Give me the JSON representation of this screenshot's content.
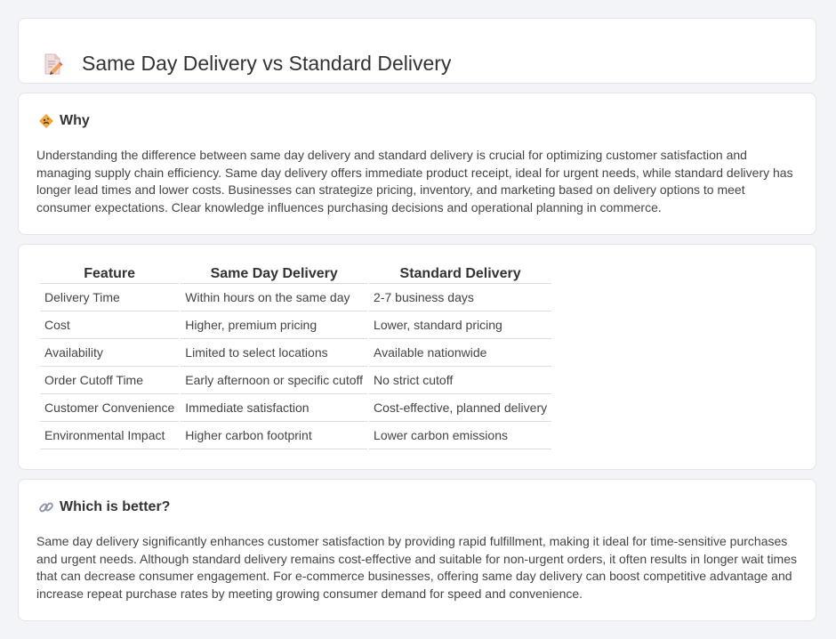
{
  "header": {
    "title": "Same Day Delivery vs Standard Delivery",
    "icon": "document-edit-icon"
  },
  "why": {
    "heading": "Why",
    "icon": "warning-diamond-icon",
    "body": "Understanding the difference between same day delivery and standard delivery is crucial for optimizing customer satisfaction and managing supply chain efficiency. Same day delivery offers immediate product receipt, ideal for urgent needs, while standard delivery has longer lead times and lower costs. Businesses can strategize pricing, inventory, and marketing based on delivery options to meet consumer expectations. Clear knowledge influences purchasing decisions and operational planning in commerce."
  },
  "table": {
    "headers": [
      "Feature",
      "Same Day Delivery",
      "Standard Delivery"
    ],
    "rows": [
      [
        "Delivery Time",
        "Within hours on the same day",
        "2-7 business days"
      ],
      [
        "Cost",
        "Higher, premium pricing",
        "Lower, standard pricing"
      ],
      [
        "Availability",
        "Limited to select locations",
        "Available nationwide"
      ],
      [
        "Order Cutoff Time",
        "Early afternoon or specific cutoff",
        "No strict cutoff"
      ],
      [
        "Customer Convenience",
        "Immediate satisfaction",
        "Cost-effective, planned delivery"
      ],
      [
        "Environmental Impact",
        "Higher carbon footprint",
        "Lower carbon emissions"
      ]
    ]
  },
  "better": {
    "heading": "Which is better?",
    "icon": "link-icon",
    "body": "Same day delivery significantly enhances customer satisfaction by providing rapid fulfillment, making it ideal for time-sensitive purchases and urgent needs. Although standard delivery remains cost-effective and suitable for non-urgent orders, it often results in longer wait times that can decrease consumer engagement. For e-commerce businesses, offering same day delivery can boost competitive advantage and increase repeat purchase rates by meeting growing consumer demand for speed and convenience."
  }
}
